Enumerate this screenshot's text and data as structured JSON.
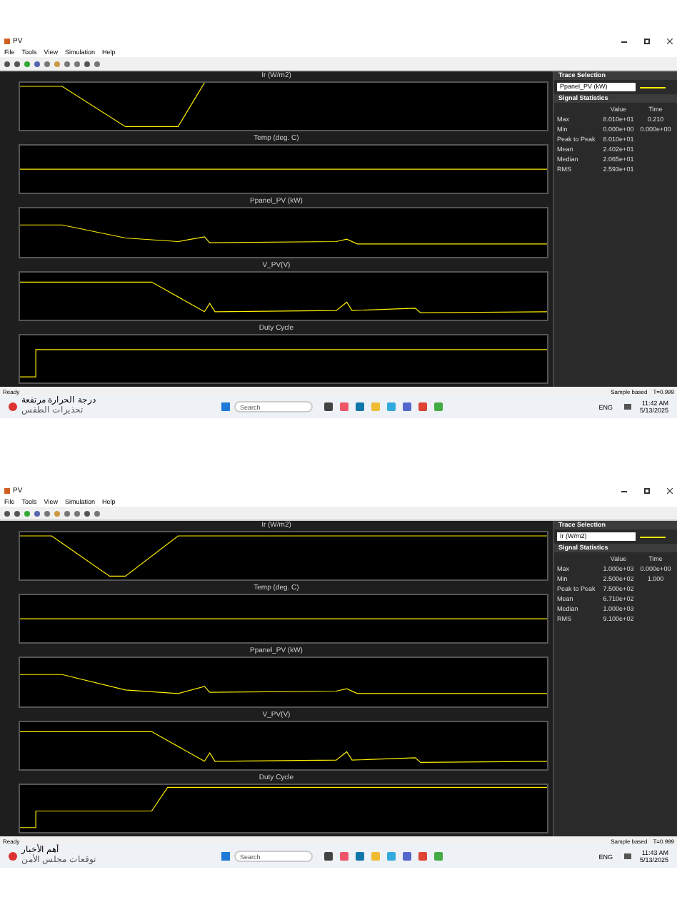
{
  "windows": [
    {
      "title": "PV",
      "menu": [
        "File",
        "Tools",
        "View",
        "Simulation",
        "Help"
      ],
      "plots": [
        {
          "title": "Ir (W/m2)"
        },
        {
          "title": "Temp (deg. C)"
        },
        {
          "title": "Ppanel_PV (kW)"
        },
        {
          "title": "V_PV(V)"
        },
        {
          "title": "Duty Cycle"
        }
      ],
      "trace_selection": {
        "header": "Trace Selection",
        "value": "Ppanel_PV (kW)"
      },
      "signal_statistics": {
        "header": "Signal Statistics",
        "columns": [
          "Value",
          "Time"
        ],
        "rows": [
          {
            "label": "Max",
            "value": "8.010e+01",
            "time": "0.210"
          },
          {
            "label": "Min",
            "value": "0.000e+00",
            "time": "0.000e+00"
          },
          {
            "label": "Peak to Peak",
            "value": "8.010e+01"
          },
          {
            "label": "Mean",
            "value": "2.402e+01"
          },
          {
            "label": "Median",
            "value": "2.065e+01"
          },
          {
            "label": "RMS",
            "value": "2.593e+01"
          }
        ]
      },
      "status_bar": {
        "left": "Ready",
        "mode": "Sample based",
        "time": "T=0.999"
      },
      "taskbar": {
        "news_title": "درجة الحرارة مرتفعة",
        "news_subtitle": "تحذيرات الطقس",
        "search": "Search",
        "language": "ENG",
        "clock": "11:42 AM",
        "date": "5/13/2025"
      }
    },
    {
      "title": "PV",
      "menu": [
        "File",
        "Tools",
        "View",
        "Simulation",
        "Help"
      ],
      "plots": [
        {
          "title": "Ir (W/m2)"
        },
        {
          "title": "Temp (deg. C)"
        },
        {
          "title": "Ppanel_PV (kW)"
        },
        {
          "title": "V_PV(V)"
        },
        {
          "title": "Duty Cycle"
        }
      ],
      "trace_selection": {
        "header": "Trace Selection",
        "value": "Ir (W/m2)"
      },
      "signal_statistics": {
        "header": "Signal Statistics",
        "columns": [
          "Value",
          "Time"
        ],
        "rows": [
          {
            "label": "Max",
            "value": "1.000e+03",
            "time": "0.000e+00"
          },
          {
            "label": "Min",
            "value": "2.500e+02",
            "time": "1.000"
          },
          {
            "label": "Peak to Peak",
            "value": "7.500e+02"
          },
          {
            "label": "Mean",
            "value": "6.710e+02"
          },
          {
            "label": "Median",
            "value": "1.000e+03"
          },
          {
            "label": "RMS",
            "value": "9.100e+02"
          }
        ]
      },
      "status_bar": {
        "left": "Ready",
        "mode": "Sample based",
        "time": "T=0.999"
      },
      "taskbar": {
        "news_title": "أهم الأخبار",
        "news_subtitle": "توقعات مجلس الأمن",
        "search": "Search",
        "language": "ENG",
        "clock": "11:43 AM",
        "date": "5/13/2025"
      }
    }
  ]
}
